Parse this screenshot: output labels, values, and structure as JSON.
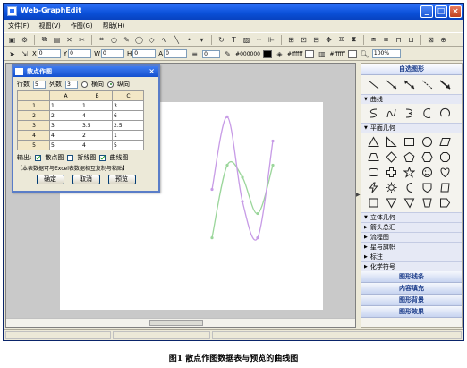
{
  "window": {
    "title": "Web-GraphEdit",
    "controls": {
      "minimize": "_",
      "maximize": "□",
      "close": "×"
    }
  },
  "menu": [
    "文件(F)",
    "视图(V)",
    "作图(G)",
    "帮助(H)"
  ],
  "toolbar2": {
    "x_label": "X",
    "x_value": "0",
    "y_label": "Y",
    "y_value": "0",
    "w_label": "W",
    "w_value": "0",
    "h_label": "H",
    "h_value": "0",
    "a_label": "A",
    "a_value": "0",
    "line_width_value": "0",
    "stroke_color_text": "#000000",
    "fill_color_text": "#ffffff",
    "bg_color_text": "#ffffff",
    "zoom_value": "100%"
  },
  "side_panel": {
    "header": "自选图形",
    "sections_open": [
      {
        "label": "曲线"
      },
      {
        "label": "平面几何"
      },
      {
        "label": "立体几何"
      }
    ],
    "sections_collapsed": [
      "箭头总汇",
      "流程图",
      "星与旗帜",
      "标注",
      "化学符号"
    ],
    "bottom_headers": [
      "图形线条",
      "内容填充",
      "图形背景",
      "图形效果"
    ],
    "icons": {
      "curves": [
        "s-curve-icon",
        "n-curve-icon",
        "c-curve-icon",
        "arc-icon",
        "circle-arc-icon"
      ]
    }
  },
  "dialog": {
    "title": "散点作图",
    "rows_label": "行数",
    "rows_value": "5",
    "cols_label": "列数",
    "cols_value": "3",
    "orientation_h": "横向",
    "orientation_v": "纵向",
    "orientation_selected": "纵向",
    "table": {
      "headers": [
        "A",
        "B",
        "C"
      ],
      "rows": [
        {
          "label": "1",
          "cells": [
            "1",
            "1",
            "3"
          ]
        },
        {
          "label": "2",
          "cells": [
            "2",
            "4",
            "6"
          ]
        },
        {
          "label": "3",
          "cells": [
            "3",
            "3.5",
            "2.5"
          ]
        },
        {
          "label": "4",
          "cells": [
            "4",
            "2",
            "1"
          ]
        },
        {
          "label": "5",
          "cells": [
            "5",
            "4",
            "5"
          ]
        }
      ]
    },
    "output_label": "输出:",
    "output_options": [
      {
        "label": "散点图",
        "checked": true
      },
      {
        "label": "折线图",
        "checked": false
      },
      {
        "label": "曲线图",
        "checked": true
      }
    ],
    "note": "【本表数据可与Excel表数据相互复制与粘贴】",
    "buttons": {
      "ok": "确定",
      "cancel": "取消",
      "preview": "预览"
    }
  },
  "chart_data": {
    "type": "line",
    "x": [
      1,
      2,
      3,
      4,
      5
    ],
    "series": [
      {
        "values": [
          1,
          4,
          3.5,
          2,
          4
        ],
        "color": "#9bd69b"
      },
      {
        "values": [
          3,
          6,
          2.5,
          1,
          5
        ],
        "color": "#c79be6"
      }
    ],
    "xlim": [
      1,
      5
    ],
    "ylim": [
      0.8,
      6.2
    ],
    "grid": false
  },
  "caption": "图1  散点作图数据表与预览的曲线图"
}
